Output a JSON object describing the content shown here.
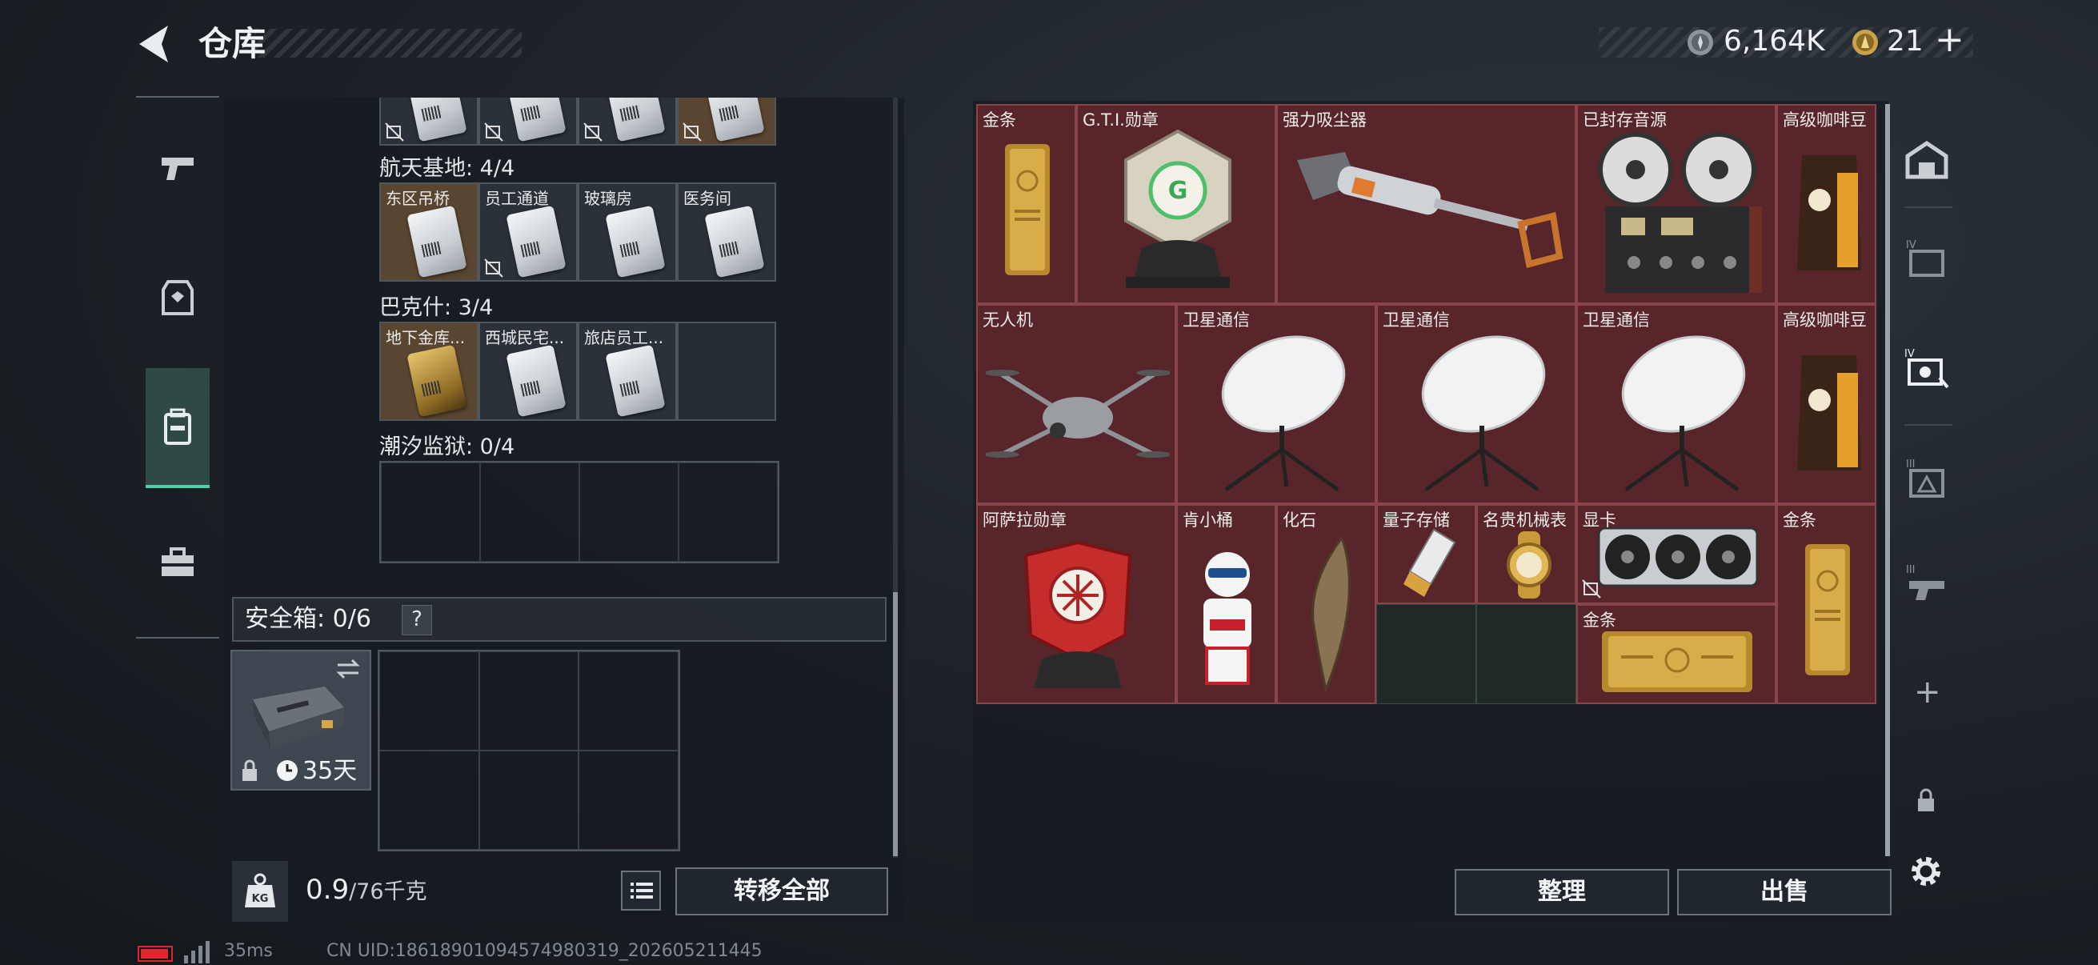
{
  "header": {
    "title": "仓库",
    "currency": [
      {
        "icon": "silver-coin-icon",
        "value": "6,164K"
      },
      {
        "icon": "gold-coin-icon",
        "value": "21"
      }
    ]
  },
  "left": {
    "sections": [
      {
        "label": "航天基地: 4/4",
        "keys": [
          "东区吊桥",
          "员工通道",
          "玻璃房",
          "医务间"
        ]
      },
      {
        "label": "巴克什: 3/4",
        "keys": [
          "地下金库...",
          "西城民宅...",
          "旅店员工..."
        ]
      },
      {
        "label": "潮汐监狱: 0/4",
        "keys": []
      }
    ],
    "safe_box": {
      "label": "安全箱: 0/6",
      "help": "?",
      "timer": "35天"
    },
    "weight": {
      "current": "0.9",
      "max": "/76千克",
      "icon_label": "KG"
    },
    "transfer_all": "转移全部"
  },
  "stash": {
    "items": [
      {
        "label": "金条"
      },
      {
        "label": "G.T.I.勋章"
      },
      {
        "label": "强力吸尘器"
      },
      {
        "label": "已封存音源"
      },
      {
        "label": "高级咖啡豆"
      },
      {
        "label": "无人机"
      },
      {
        "label": "卫星通信"
      },
      {
        "label": "卫星通信"
      },
      {
        "label": "卫星通信"
      },
      {
        "label": "高级咖啡豆"
      },
      {
        "label": "阿萨拉勋章"
      },
      {
        "label": "肯小桶"
      },
      {
        "label": "化石"
      },
      {
        "label": "量子存储"
      },
      {
        "label": "名贵机械表"
      },
      {
        "label": "显卡"
      },
      {
        "label": "金条"
      },
      {
        "label": "金条"
      }
    ],
    "sort_button": "整理",
    "sell_button": "出售"
  },
  "status": {
    "ping": "35ms",
    "uid": "CN UID:18618901094574980319_202605211445"
  },
  "colors": {
    "accent": "#4fd1a8",
    "stash_bg": "#4a1f22",
    "battery": "#e0262b"
  }
}
